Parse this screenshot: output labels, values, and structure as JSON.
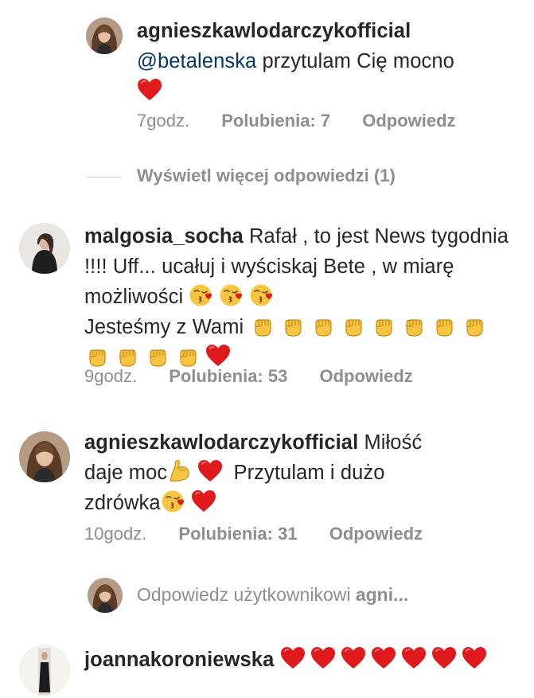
{
  "comments": [
    {
      "username": "agnieszkawlodarczykofficial",
      "mention": "@betalenska",
      "text": "przytulam Cię mocno",
      "time": "7godz.",
      "likes": "Polubienia: 7",
      "reply": "Odpowiedz"
    },
    {
      "username": "malgosia_socha",
      "text_1": "Rafał , to jest News tygodnia !!!! Uff... ucałuj i wyściskaj Bete , w miarę możliwości",
      "text_2": "Jesteśmy z Wami",
      "time": "9godz.",
      "likes": "Polubienia: 53",
      "reply": "Odpowiedz"
    },
    {
      "username": "agnieszkawlodarczykofficial",
      "text_1": "Miłość daje moc",
      "text_2": "Przytulam i dużo zdrówka",
      "time": "10godz.",
      "likes": "Polubienia: 31",
      "reply": "Odpowiedz"
    },
    {
      "username": "joannakoroniewska"
    }
  ],
  "view_more_replies": "Wyświetl więcej odpowiedzi (1)",
  "reply_input": {
    "prefix": "Odpowiedz użytkownikowi",
    "username": "agni..."
  },
  "icons": {
    "heart": "red-heart-icon",
    "kiss": "face-blowing-kiss-icon",
    "fist": "raised-fist-icon",
    "muscle": "flexed-biceps-icon"
  },
  "colors": {
    "text": "#262626",
    "meta": "#8e8e8e",
    "mention": "#003569",
    "heart": "#e0191d"
  }
}
